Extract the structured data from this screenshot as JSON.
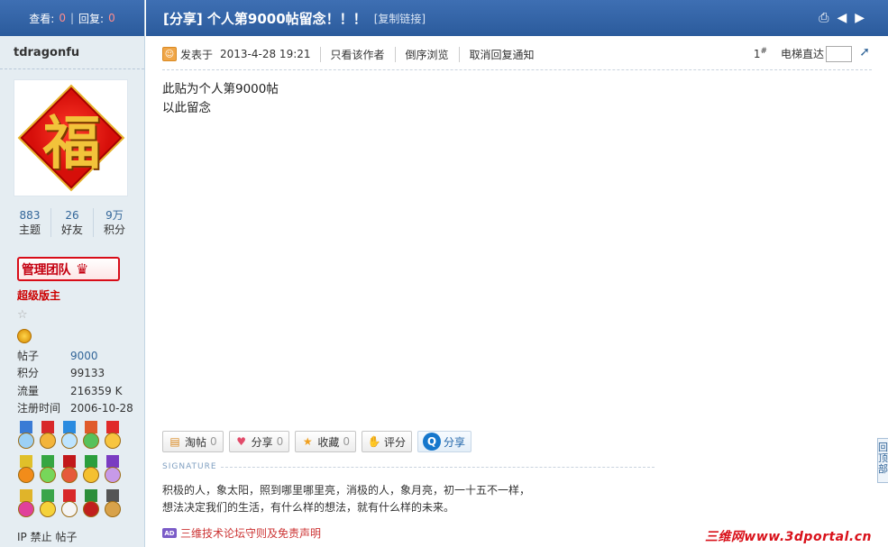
{
  "sidebar": {
    "views_label": "查看:",
    "views_count": "0",
    "replies_label": "回复:",
    "replies_count": "0",
    "username": "tdragonfu",
    "avatar_text": "福",
    "stats": [
      {
        "value": "883",
        "label": "主题"
      },
      {
        "value": "26",
        "label": "好友"
      },
      {
        "value": "9万",
        "label": "积分"
      }
    ],
    "badge_text": "管理团队",
    "role": "超级版主",
    "info": [
      {
        "key": "帖子",
        "value": "9000"
      },
      {
        "key": "积分",
        "value": "99133"
      },
      {
        "key": "流量",
        "value": "216359 K"
      },
      {
        "key": "注册时间",
        "value": "2006-10-28"
      }
    ],
    "ip_ban": "IP",
    "ban_label": "禁止",
    "post_label": "帖子"
  },
  "header": {
    "title": "[分享] 个人第9000帖留念！！！",
    "copy_link": "[复制链接]"
  },
  "postbar": {
    "posted_label": "发表于",
    "date": "2013-4-28 19:21",
    "links": [
      "只看该作者",
      "倒序浏览",
      "取消回复通知"
    ],
    "floor_num": "1",
    "floor_sup": "#",
    "elevator_label": "电梯直达",
    "elevator_value": ""
  },
  "post": {
    "lines": [
      "此贴为个人第9000帖",
      "以此留念"
    ]
  },
  "actions": {
    "tao": {
      "label": "淘帖",
      "count": "0"
    },
    "share": {
      "label": "分享",
      "count": "0"
    },
    "fav": {
      "label": "收藏",
      "count": "0"
    },
    "rate": {
      "label": "评分"
    },
    "qq_share": {
      "label": "分享"
    }
  },
  "signature": {
    "label": "SIGNATURE",
    "lines": [
      "积极的人，象太阳，照到哪里哪里亮，消极的人，象月亮，初一十五不一样，",
      "想法决定我们的生活，有什么样的想法，就有什么样的未来。"
    ]
  },
  "declaration": {
    "ad_badge": "AD",
    "text": "三维技术论坛守则及免责声明"
  },
  "backtop": "回顶部",
  "watermark": "三维网www.3dportal.cn",
  "colors": {
    "header_bg": "#2b5b9c",
    "sidebar_bg": "#e5edf2",
    "link": "#336699",
    "role_red": "#cc0000"
  }
}
